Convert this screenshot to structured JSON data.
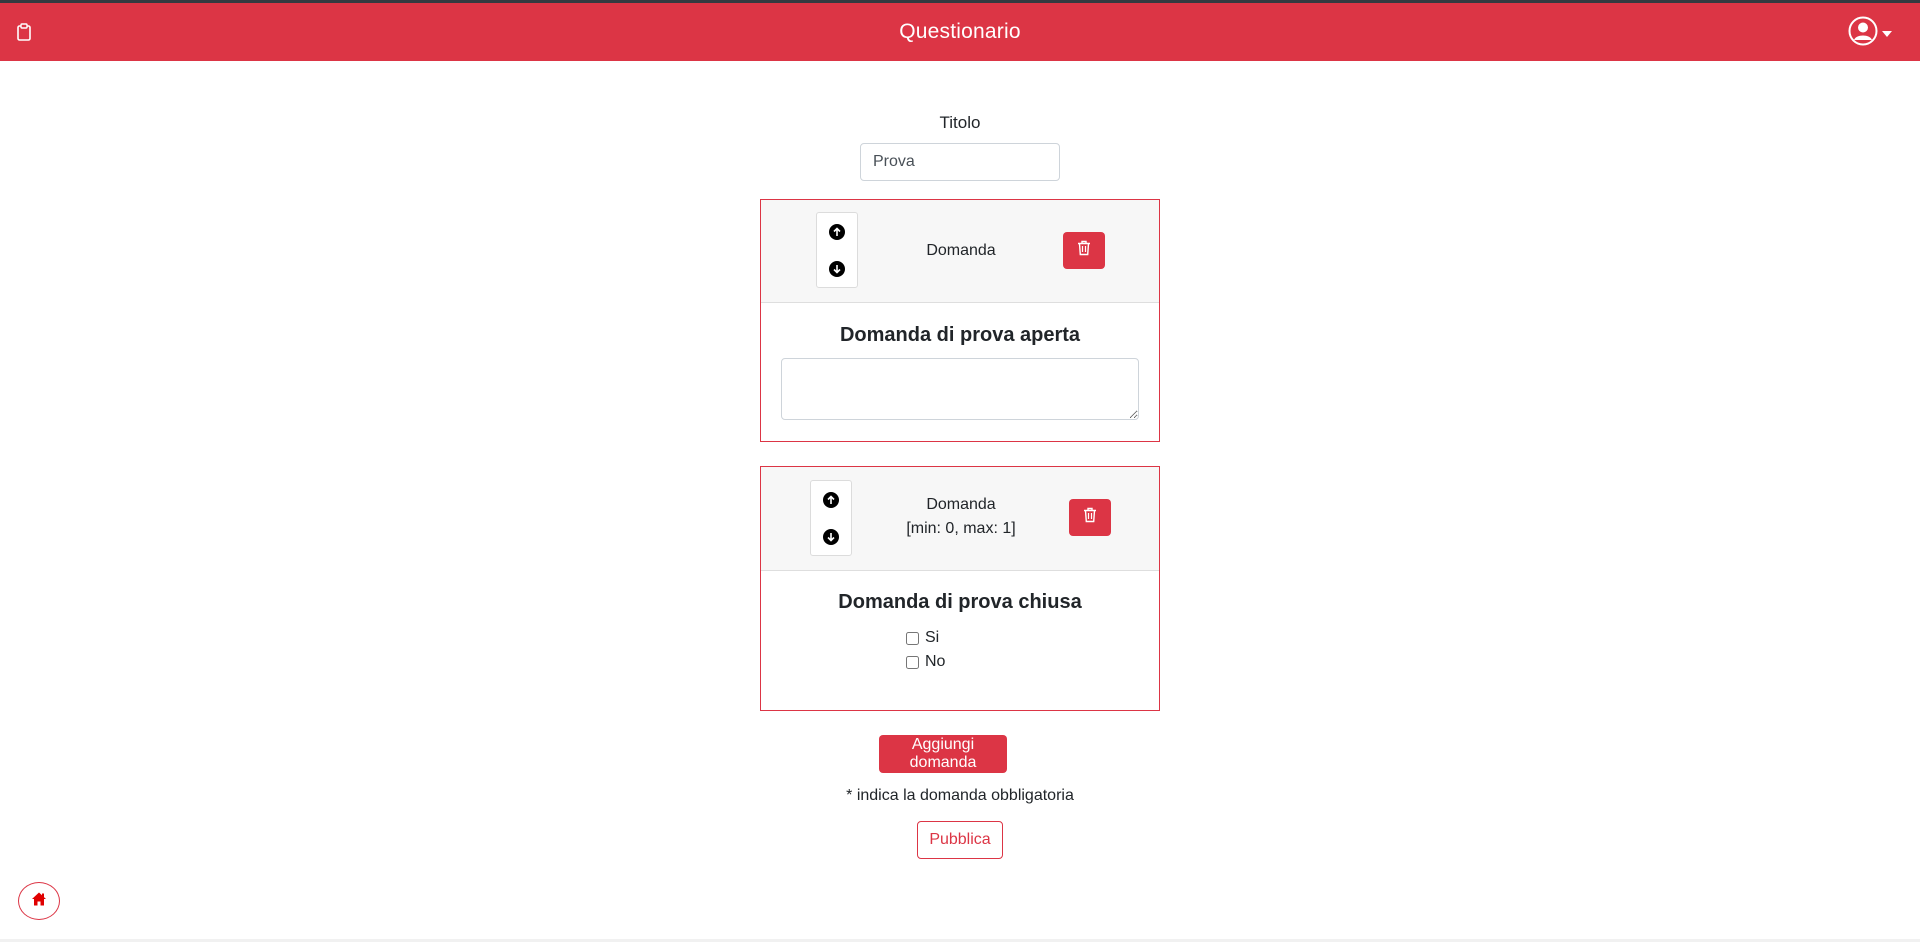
{
  "navbar": {
    "title": "Questionario",
    "left_icon": "clipboard-icon",
    "right_icon": "user-circle-icon",
    "accent": "#dc3545"
  },
  "form": {
    "title_label": "Titolo",
    "title_value": "Prova"
  },
  "questions": [
    {
      "header_label": "Domanda",
      "header_range": "",
      "title": "Domanda di prova aperta",
      "type": "open",
      "answer_value": ""
    },
    {
      "header_label": "Domanda",
      "header_range": "[min: 0, max: 1]",
      "title": "Domanda di prova chiusa",
      "type": "closed",
      "options": [
        {
          "label": "Si",
          "checked": false
        },
        {
          "label": "No",
          "checked": false
        }
      ]
    }
  ],
  "actions": {
    "add_question": "Aggiungi domanda",
    "required_note": "* indica la domanda obbligatoria",
    "publish": "Pubblica"
  },
  "floating": {
    "home_icon": "home-icon"
  }
}
